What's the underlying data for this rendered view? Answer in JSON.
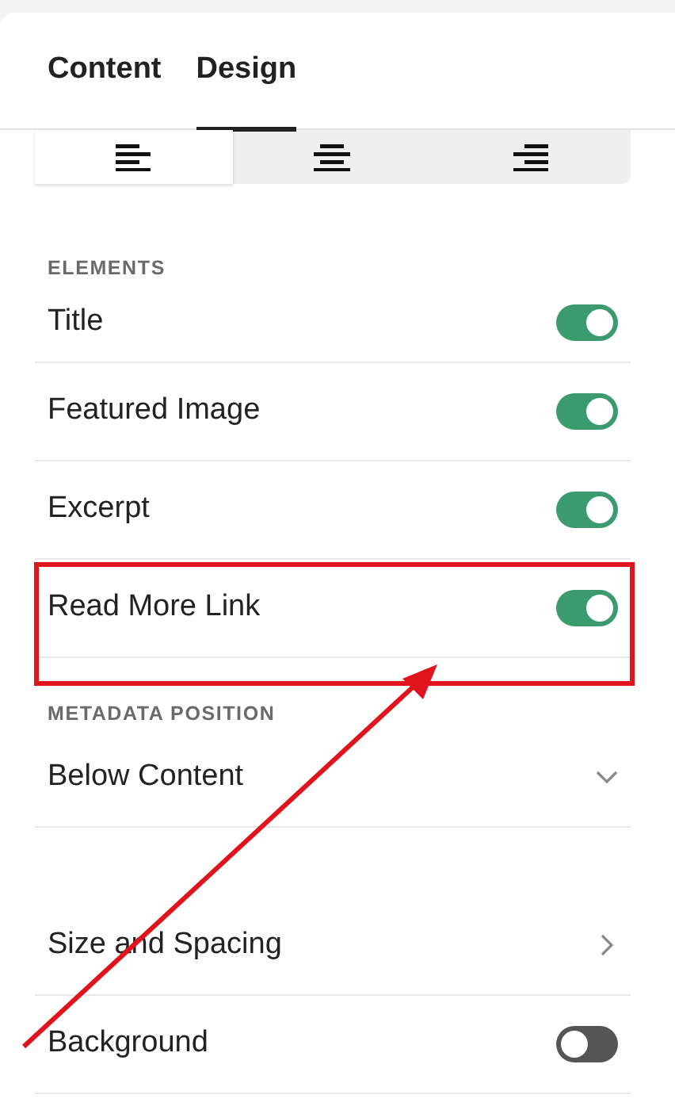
{
  "tabs": [
    {
      "label": "Content",
      "selected": false
    },
    {
      "label": "Design",
      "selected": true
    }
  ],
  "alignment": [
    {
      "kind": "left",
      "selected": true
    },
    {
      "kind": "center",
      "selected": false
    },
    {
      "kind": "right",
      "selected": false
    }
  ],
  "sections": [
    {
      "heading": "ELEMENTS",
      "rows": [
        {
          "kind": "toggle",
          "label": "Title",
          "on": true
        },
        {
          "kind": "toggle",
          "label": "Featured Image",
          "on": true
        },
        {
          "kind": "toggle",
          "label": "Excerpt",
          "on": true
        },
        {
          "kind": "toggle",
          "label": "Read More Link",
          "on": true
        }
      ]
    },
    {
      "heading": "METADATA POSITION",
      "rows": [
        {
          "kind": "dropdown",
          "label": "Below Content"
        },
        {
          "kind": "spacer"
        },
        {
          "kind": "link",
          "label": "Size and Spacing"
        },
        {
          "kind": "toggle",
          "label": "Background",
          "on": false
        }
      ]
    }
  ]
}
